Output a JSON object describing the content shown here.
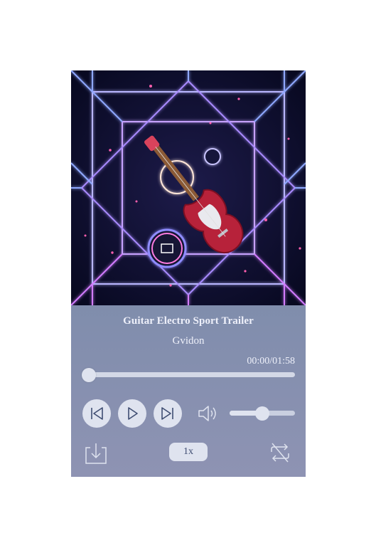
{
  "track": {
    "title": "Guitar Electro Sport Trailer",
    "artist": "Gvidon",
    "cover_alt": "Electric guitar floating in neon geometric cube",
    "time_display": "00:00/01:58",
    "progress_fraction": 0.0
  },
  "controls": {
    "prev_icon": "skip-previous-icon",
    "play_icon": "play-icon",
    "next_icon": "skip-next-icon",
    "volume_icon": "volume-icon",
    "volume_fraction": 0.5,
    "speed_label": "1x",
    "download_icon": "download-icon",
    "repeat_icon": "repeat-icon"
  },
  "colors": {
    "panel_top": "#6f84a6",
    "panel_bottom": "#8e93b3",
    "button_bg": "#dfe3ef",
    "text": "#eef0fa",
    "icon": "#3f4d72"
  }
}
